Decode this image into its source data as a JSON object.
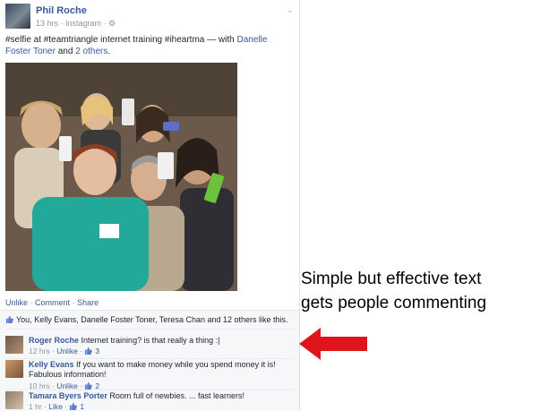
{
  "post": {
    "author": "Phil Roche",
    "time": "13 hrs",
    "source": "Instagram",
    "text_prefix": "#selfie at #teamtriangle internet training #iheartma — with ",
    "tagged_1": "Danelle Foster Toner",
    "text_and": " and ",
    "tagged_others": "2 others",
    "text_end": "."
  },
  "actions": {
    "unlike": "Unlike",
    "comment": "Comment",
    "share": "Share"
  },
  "likes": {
    "text": "You, Kelly Evans, Danelle Foster Toner, Teresa Chan and 12 others like this."
  },
  "comments": [
    {
      "author": "Roger Roche",
      "text": "Internet training? is that really a thing :|",
      "time": "12 hrs",
      "action": "Unlike",
      "likes": "3"
    },
    {
      "author": "Kelly Evans",
      "text": "If you want to make money while you spend money it is! Fabulous information!",
      "time": "10 hrs",
      "action": "Unlike",
      "likes": "2"
    },
    {
      "author": "Tamara Byers Porter",
      "text": "Room full of newbies. ... fast learners!",
      "time": "1 hr",
      "action": "Like",
      "likes": "1"
    }
  ],
  "annotation": {
    "line1": "Simple but effective text",
    "line2": "gets people commenting"
  },
  "colors": {
    "link": "#3b5998",
    "arrow": "#e0141b",
    "meta": "#90949c"
  }
}
